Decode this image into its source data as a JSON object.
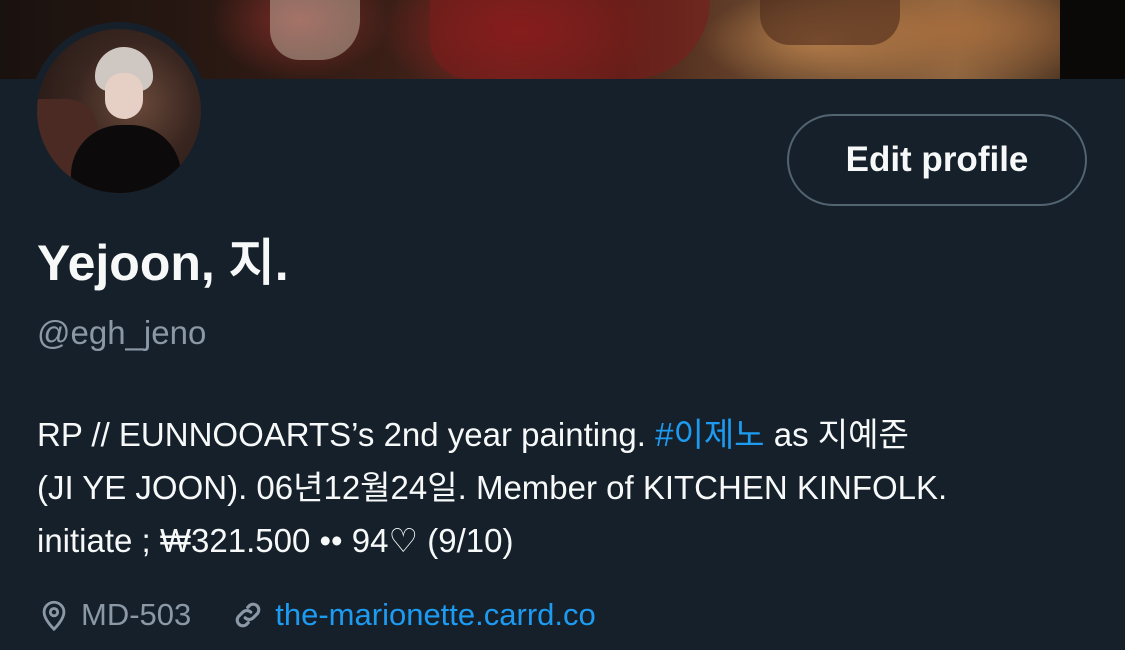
{
  "profile": {
    "display_name": "Yejoon, 지.",
    "handle": "@egh_jeno",
    "edit_button_label": "Edit profile",
    "bio": {
      "line1_pre": "RP // EUNNOOARTS’s 2nd year painting. ",
      "line1_hashtag": "#이제노",
      "line1_post": " as 지예준",
      "line2": "(JI YE JOON). 06년12월24일. Member of KITCHEN KINFOLK.",
      "line3": "initiate ; ₩321.500 •• 94♡ (9/10)"
    },
    "location": "MD-503",
    "website": "the-marionette.carrd.co"
  },
  "icons": {
    "location": "location-pin-icon",
    "link": "link-icon"
  },
  "colors": {
    "background": "#15202b",
    "accent": "#1d9bf0",
    "secondary_text": "#8b98a5",
    "button_border": "#536471"
  }
}
